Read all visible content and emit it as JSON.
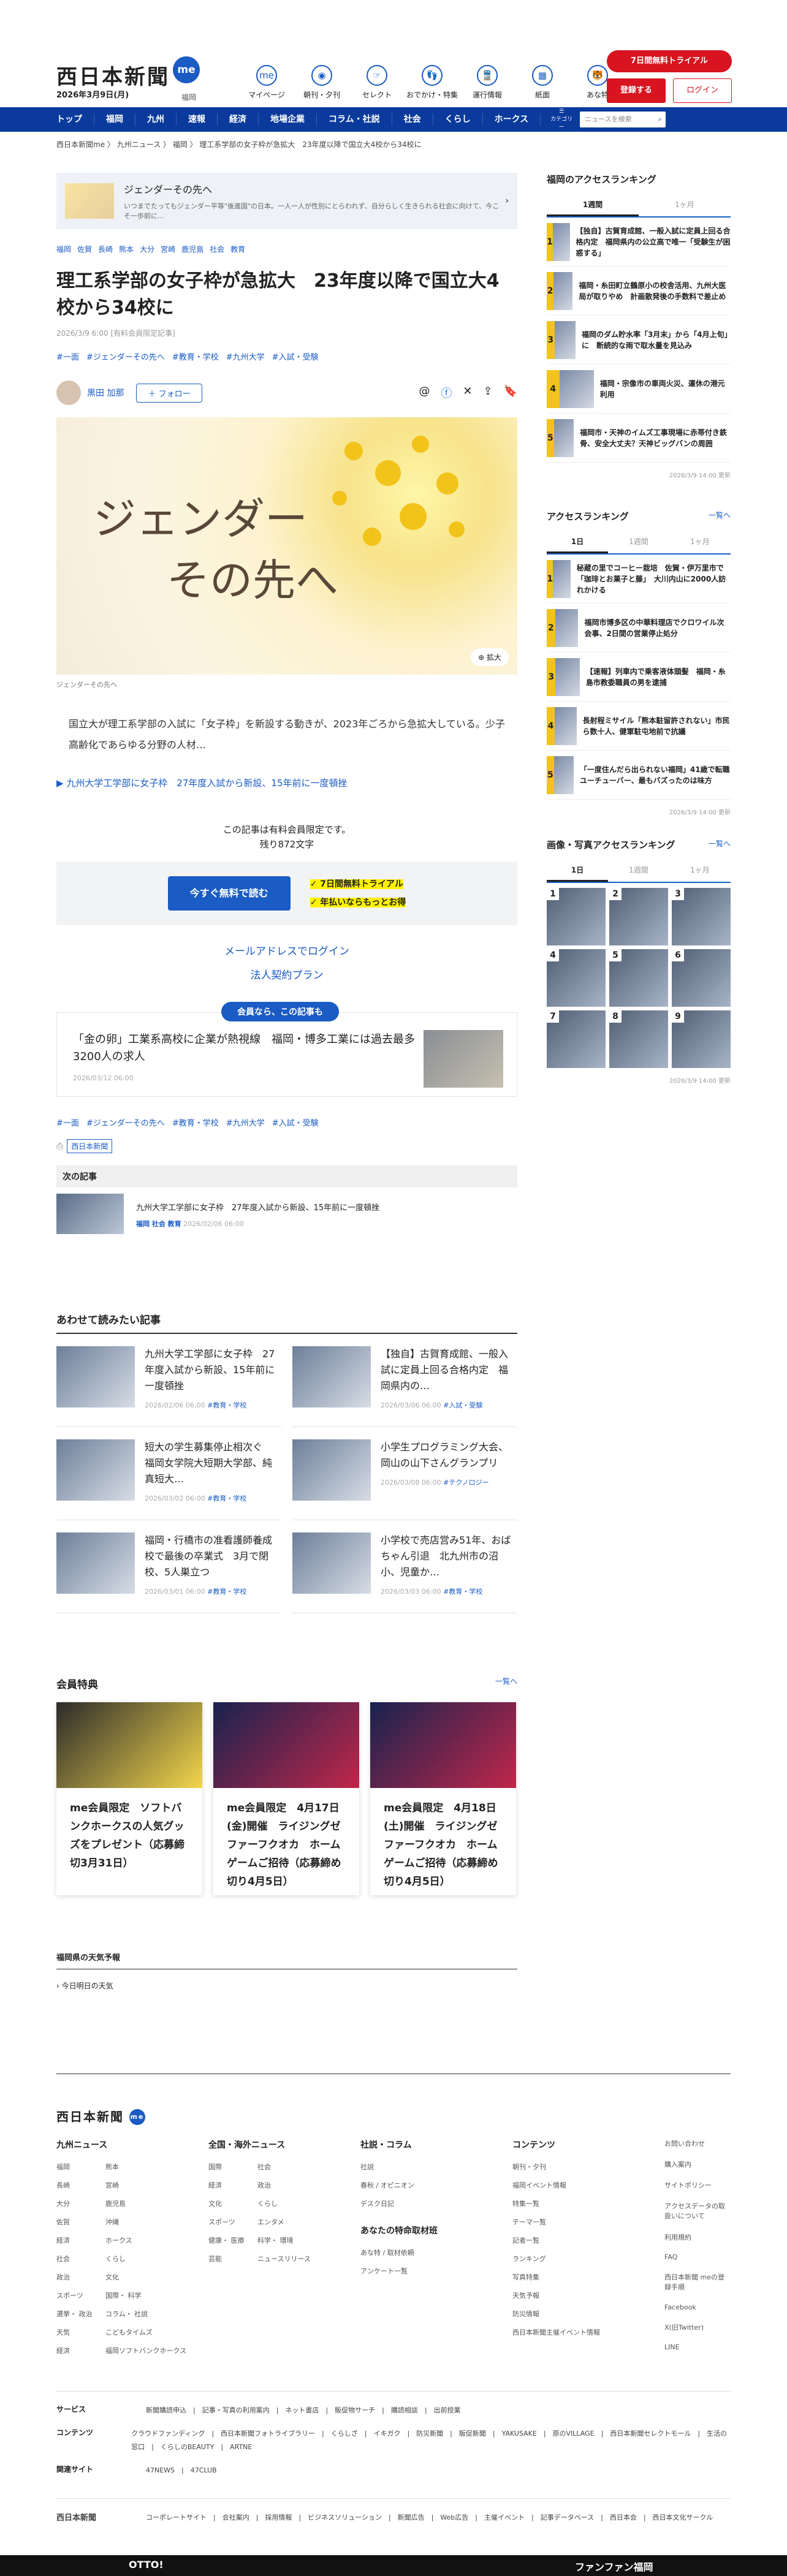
{
  "header": {
    "logo": "西日本新聞",
    "logo_badge": "me",
    "date": "2026年3月9日(月)",
    "region": "福岡",
    "topnav": [
      {
        "icon": "me",
        "label": "マイページ"
      },
      {
        "icon": "◉",
        "label": "朝刊・夕刊"
      },
      {
        "icon": "☞",
        "label": "セレクト"
      },
      {
        "icon": "👣",
        "label": "おでかけ・特集"
      },
      {
        "icon": "🚆",
        "label": "運行情報"
      },
      {
        "icon": "▦",
        "label": "紙面"
      },
      {
        "icon": "🐯",
        "label": "あな特"
      }
    ],
    "trial": "7日間無料トライアル",
    "register": "登録する",
    "login": "ログイン"
  },
  "nav": {
    "items": [
      "トップ",
      "福岡",
      "九州",
      "速報",
      "経済",
      "地場企業",
      "コラム・社説",
      "社会",
      "くらし",
      "ホークス"
    ],
    "cat": "カテゴリー",
    "search_placeholder": "ニュースを検索"
  },
  "breadcrumb": "西日本新聞me 〉 九州ニュース 〉 福岡 〉 理工系学部の女子枠が急拡大　23年度以降で国立大4校から34校に",
  "banner": {
    "title": "ジェンダーその先へ",
    "text": "いつまでたってもジェンダー平等\"後進国\"の日本。一人一人が性別にとらわれず、自分らしく生きられる社会に向けて、今こそ一歩前に…"
  },
  "article": {
    "region_tags": [
      "福岡",
      "佐賀",
      "長崎",
      "熊本",
      "大分",
      "宮崎",
      "鹿児島",
      "社会",
      "教育"
    ],
    "title": "理工系学部の女子枠が急拡大　23年度以降で国立大4校から34校に",
    "meta": "2026/3/9 6:00 [有料会員限定記事]",
    "hashtags": [
      "#一面",
      "#ジェンダーその先へ",
      "#教育・学校",
      "#九州大学",
      "#入試・受験"
    ],
    "author": "黒田 加那",
    "follow": "＋ フォロー",
    "hero_line1": "ジェンダー",
    "hero_line2": "その先へ",
    "enlarge": "拡大",
    "caption": "ジェンダーその先へ",
    "lead": "国立大が理工系学部の入試に「女子枠」を新設する動きが、2023年ごろから急拡大している。少子高齢化であらゆる分野の人材…",
    "related": "九州大学工学部に女子枠　27年度入試から新設、15年前に一度頓挫",
    "paywall": "この記事は有料会員限定です。",
    "remaining": "残り872文字",
    "read_btn": "今すぐ無料で読む",
    "check1": "✓ 7日間無料トライアル",
    "check2": "✓ 年払いならもっとお得",
    "login_link": "メールアドレスでログイン",
    "corp_link": "法人契約プラン",
    "member_badge": "会員なら、この記事も",
    "member_title": "「金の卵」工業系高校に企業が熱視線　福岡・博多工業には過去最多3200人の求人",
    "member_date": "2026/03/12 06:00",
    "bottom_tags": [
      "#一面",
      "#ジェンダーその先へ",
      "#教育・学校",
      "#九州大学",
      "#入試・受験"
    ],
    "source": "西日本新聞",
    "next_label": "次の記事",
    "next_title": "九州大学工学部に女子枠　27年度入試から新設、15年前に一度頓挫",
    "next_tags": "福岡 社会 教育",
    "next_date": "2026/02/06 06:00"
  },
  "read_more": {
    "title": "あわせて読みたい記事",
    "items": [
      {
        "title": "九州大学工学部に女子枠　27年度入試から新設、15年前に一度頓挫",
        "date": "2026/02/06 06:00",
        "tag": "#教育・学校"
      },
      {
        "title": "【独自】古賀育成館、一般入試に定員上回る合格内定　福岡県内の…",
        "date": "2026/03/06 06:00",
        "tag": "#入試・受験"
      },
      {
        "title": "短大の学生募集停止相次ぐ　福岡女学院大短期大学部、純真短大…",
        "date": "2026/03/02 06:00",
        "tag": "#教育・学校"
      },
      {
        "title": "小学生プログラミング大会、岡山の山下さんグランプリ",
        "date": "2026/03/08 06:00",
        "tag": "#テクノロジー"
      },
      {
        "title": "福岡・行橋市の准看護師養成校で最後の卒業式　3月で閉校、5人巣立つ",
        "date": "2026/03/01 06:00",
        "tag": "#教育・学校"
      },
      {
        "title": "小学校で売店営み51年、おばちゃん引退　北九州市の沼小、児童か…",
        "date": "2026/03/03 06:00",
        "tag": "#教育・学校"
      }
    ]
  },
  "perks": {
    "title": "会員特典",
    "more": "一覧へ",
    "items": [
      {
        "title": "me会員限定　ソフトバンクホークスの人気グッズをプレゼント（応募締切3月31日）"
      },
      {
        "title": "me会員限定　4月17日(金)開催　ライジングゼファーフクオカ　ホームゲームご招待（応募締め切り4月5日）"
      },
      {
        "title": "me会員限定　4月18日(土)開催　ライジングゼファーフクオカ　ホームゲームご招待（応募締め切り4月5日）"
      }
    ]
  },
  "weather": {
    "title": "福岡県の天気予報",
    "text": "今日明日の天気"
  },
  "sidebar": {
    "fk_title": "福岡のアクセスランキング",
    "fk_tabs": [
      "1週間",
      "1ヶ月"
    ],
    "fk_items": [
      "【独自】古賀育成館、一般入試に定員上回る合格内定　福岡県内の公立高で唯一「受験生が困惑する」",
      "福岡・糸田町立鶴原小の校舎活用、九州大医局が取りやめ　計画散発後の手数料で差止め",
      "福岡のダム貯水率「3月末」から「4月上旬」に　断続的な雨で取水量を見込み",
      "福岡・宗像市の車両火災、運休の港元利用",
      "福岡市・天神のイムズ工事現場に赤帯付き鉄骨、安全大丈夫？天神ビッグバンの周囲",
      ""
    ],
    "fk_update": "2026/3/9 14:00 更新",
    "ak_title": "アクセスランキング",
    "ak_more": "一覧へ",
    "ak_tabs": [
      "1日",
      "1週間",
      "1ヶ月"
    ],
    "ak_items": [
      "秘蔵の里でコーヒー栽培　佐賀・伊万里市で「珈琲とお菓子と藤」　大川内山に2000人訪れかける",
      "福岡市博多区の中華料理店でクロワイル次会事、2日間の営業停止処分",
      "【速報】列車内で乗客液体頭髪　福岡・糸島市教委職員の男を逮捕",
      "長射程ミサイル「熊本駐留許されない」市民ら数十人、健軍駐屯地前で抗議",
      "「一度住んだら出られない福岡」41歳で転職ユーチューバー、最もバズったのは味方"
    ],
    "ak_update": "2026/3/9 14:00 更新",
    "ph_title": "画像・写真アクセスランキング",
    "ph_more": "一覧へ",
    "ph_tabs": [
      "1日",
      "1週間",
      "1ヶ月"
    ],
    "ph_update": "2026/3/9 14:00 更新"
  },
  "footer": {
    "logo": "西日本新聞",
    "badge": "me",
    "c1_title": "九州ニュース",
    "c1": [
      "福岡",
      "熊本",
      "長崎",
      "宮崎",
      "大分",
      "鹿児島",
      "佐賀",
      "沖縄",
      "経済",
      "ホークス",
      "社会",
      "くらし",
      "政治",
      "文化",
      "スポーツ",
      "国際・ 科学",
      "選挙・ 政治",
      "コラム・ 社説",
      "天気",
      "こどもタイムズ",
      "経済",
      "福岡ソフトバンクホークス"
    ],
    "c2_title": "全国・海外ニュース",
    "c2": [
      "国際",
      "社会",
      "経済",
      "政治",
      "文化",
      "くらし",
      "スポーツ",
      "エンタメ",
      "健康・ 医療",
      "科学・ 環境",
      "芸能",
      "ニュースリリース"
    ],
    "c3_title": "社説・コラム",
    "c3": [
      "社説",
      "春秋 / オピニオン",
      "デスク日記"
    ],
    "c3b_title": "あなたの特命取材班",
    "c3b": [
      "あな特 / 取材依頼",
      "アンケート一覧"
    ],
    "c4_title": "コンテンツ",
    "c4": [
      "朝刊・夕刊",
      "福岡イベント情報",
      "特集一覧",
      "テーマ一覧",
      "記者一覧",
      "ランキング",
      "写真特集",
      "天気予報",
      "防災情報",
      "西日本新聞主催イベント情報"
    ],
    "side": [
      "お問い合わせ",
      "購入案内",
      "サイトポリシー",
      "アクセスデータの取扱いについて",
      "利用規約",
      "FAQ",
      "西日本新聞 meの登録手順",
      "Facebook",
      "X(旧Twitter)",
      "LINE"
    ],
    "svc_label": "サービス",
    "svc": "新聞購読申込　|　記事・写真の利用案内　|　ネット書店　|　販促物サーチ　|　購読相談　|　出前授業",
    "cnt_label": "コンテンツ",
    "cnt": "クラウドファンディング　|　西日本新聞フォトライブラリー　|　くらしざ　|　イキガク　|　防災新聞　|　販促新聞　|　YAKUSAKE　|　原のVILLAGE　|　西日本新聞セレクトモール　|　生活の窓口　|　くらしのBEAUTY　|　ARTNE",
    "rel_label": "関連サイト",
    "rel": "47NEWS　|　47CLUB",
    "bot_logo": "西日本新聞",
    "bot": "コーポレートサイト　|　会社案内　|　採用情報　|　ビジネスソリューション　|　新聞広告　|　Web広告　|　主催イベント　|　記事データベース　|　西日本会　|　西日本文化サークル"
  },
  "darkbar": {
    "left": "OTTO!",
    "right": "ファンファン福岡"
  }
}
